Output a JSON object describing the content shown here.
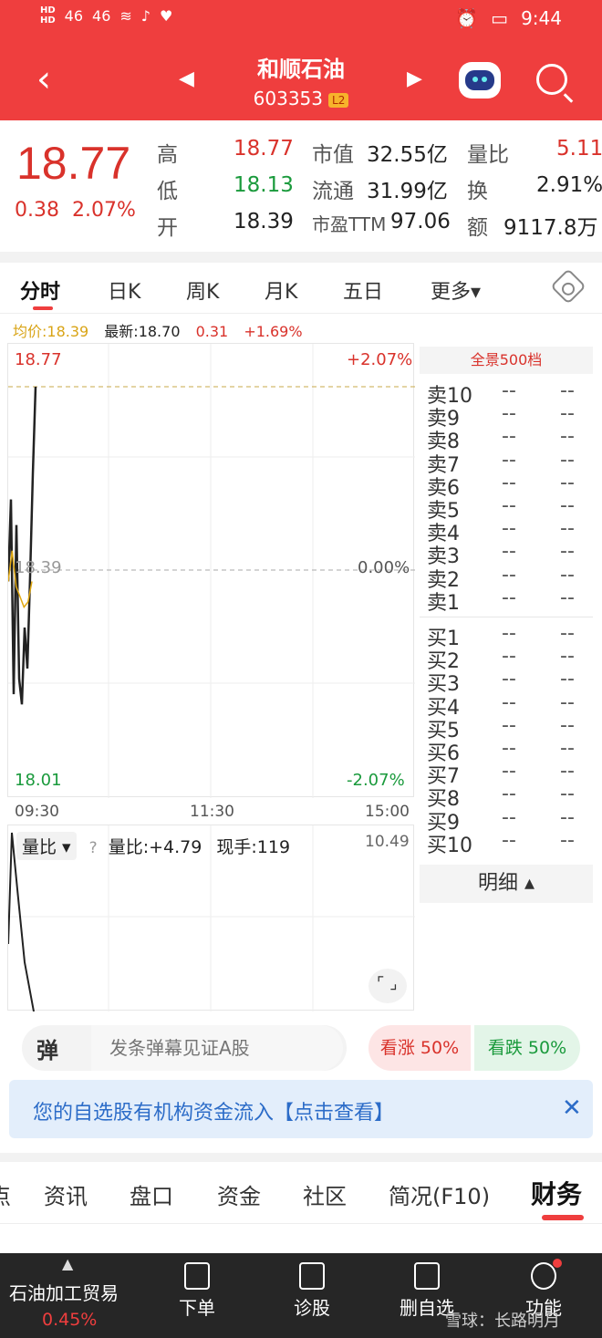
{
  "status_bar": {
    "hd1": "HD",
    "hd2": "HD",
    "signal1": "46",
    "signal2": "46",
    "time": "9:44"
  },
  "header": {
    "name": "和顺石油",
    "code": "603353",
    "level": "L2"
  },
  "quote": {
    "price": "18.77",
    "change": "0.38",
    "change_pct": "2.07%",
    "high_label": "高",
    "high": "18.77",
    "low_label": "低",
    "low": "18.13",
    "open_label": "开",
    "open": "18.39",
    "mktcap_label": "市值",
    "mktcap": "32.55亿",
    "float_label": "流通",
    "float": "31.99亿",
    "pe_label": "市盈TTM",
    "pe": "97.06",
    "volratio_label": "量比",
    "volratio": "5.11",
    "turnover_label": "换",
    "turnover": "2.91%",
    "amount_label": "额",
    "amount": "9117.8万"
  },
  "tabs": [
    "分时",
    "日K",
    "周K",
    "月K",
    "五日",
    "更多▾"
  ],
  "info": {
    "avg": "均价:18.39",
    "latest": "最新:18.70",
    "chg": "0.31",
    "pct": "+1.69%"
  },
  "chart": {
    "top": "18.77",
    "top_pct": "+2.07%",
    "mid": "18.39",
    "mid_pct": "0.00%",
    "bottom": "18.01",
    "bottom_pct": "-2.07%",
    "t1": "09:30",
    "t2": "11:30",
    "t3": "15:00"
  },
  "chart_data": {
    "type": "line",
    "title": "",
    "xlabel": "",
    "ylabel": "",
    "x_ticks": [
      "09:30",
      "11:30",
      "15:00"
    ],
    "ylim": [
      18.01,
      18.77
    ],
    "series": [
      {
        "values": [
          18.39,
          18.55,
          18.17,
          18.5,
          18.2,
          18.15,
          18.3,
          18.22,
          18.4,
          18.6,
          18.77
        ]
      },
      {
        "values": [
          18.39,
          18.45,
          18.38,
          18.36,
          18.34,
          18.35,
          18.39
        ]
      }
    ]
  },
  "volume": {
    "selector": "量比 ▾",
    "help": "?",
    "ratio": "量比:+4.79",
    "hand": "现手:119",
    "max": "10.49"
  },
  "book": {
    "title": "全景500档",
    "sells": [
      "卖10",
      "卖9",
      "卖8",
      "卖7",
      "卖6",
      "卖5",
      "卖4",
      "卖3",
      "卖2",
      "卖1"
    ],
    "buys": [
      "买1",
      "买2",
      "买3",
      "买4",
      "买5",
      "买6",
      "买7",
      "买8",
      "买9",
      "买10"
    ],
    "empty": "--",
    "detail": "明细 ▴"
  },
  "danmu": {
    "icon": "弹",
    "placeholder": "发条弹幕见证A股",
    "bull": "看涨 50%",
    "bear": "看跌 50%"
  },
  "banner": {
    "text": "您的自选股有机构资金流入【点击查看】",
    "close": "✕"
  },
  "bottom_tabs": [
    "点",
    "资讯",
    "盘口",
    "资金",
    "社区",
    "简况(F10)",
    "财务"
  ],
  "bottom_bar": {
    "industry": "石油加工贸易",
    "industry_pct": "0.45%",
    "nav": [
      "下单",
      "诊股",
      "删自选",
      "功能"
    ]
  },
  "watermark": "雪球：长路明月"
}
